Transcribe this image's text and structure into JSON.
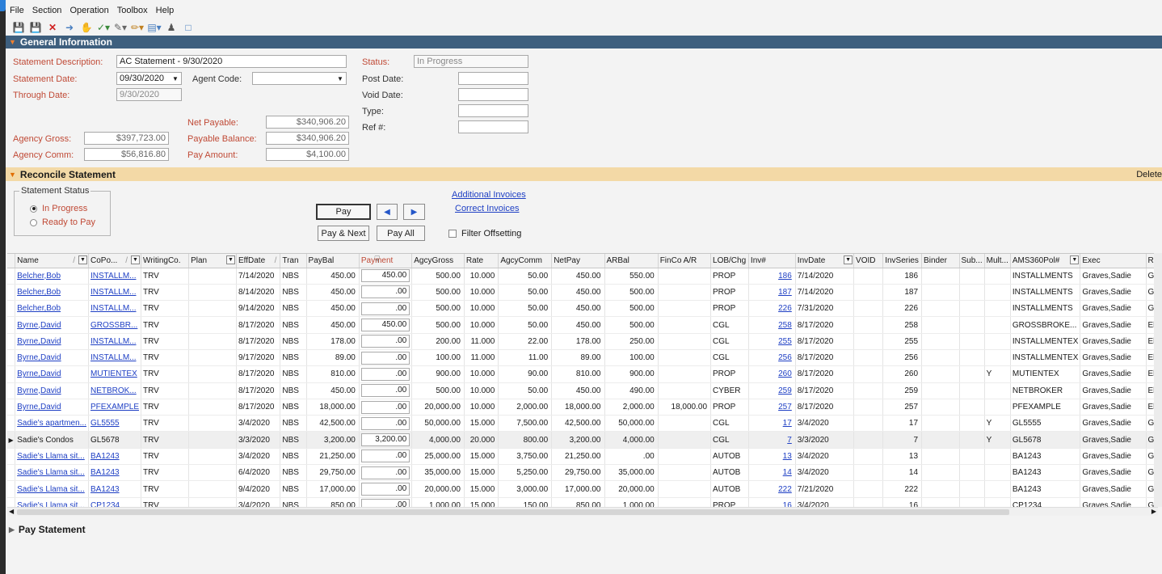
{
  "menu": [
    "File",
    "Section",
    "Operation",
    "Toolbox",
    "Help"
  ],
  "toolbar_icons": [
    "save-icon",
    "save-close-icon",
    "close-x-icon",
    "attach-icon",
    "hand-icon",
    "checkmark-dropdown-icon",
    "attach-dropdown-icon",
    "pen-dropdown-icon",
    "document-dropdown-icon",
    "people-icon",
    "blank-page-icon"
  ],
  "general": {
    "title": "General Information",
    "statement_description_label": "Statement Description:",
    "statement_description": "AC Statement - 9/30/2020",
    "statement_date_label": "Statement Date:",
    "statement_date": "09/30/2020",
    "agent_code_label": "Agent Code:",
    "agent_code": "",
    "through_date_label": "Through Date:",
    "through_date": "9/30/2020",
    "status_label": "Status:",
    "status": "In Progress",
    "post_date_label": "Post Date:",
    "void_date_label": "Void Date:",
    "type_label": "Type:",
    "ref_label": "Ref #:",
    "net_payable_label": "Net Payable:",
    "net_payable": "$340,906.20",
    "agency_gross_label": "Agency Gross:",
    "agency_gross": "$397,723.00",
    "payable_balance_label": "Payable Balance:",
    "payable_balance": "$340,906.20",
    "agency_comm_label": "Agency Comm:",
    "agency_comm": "$56,816.80",
    "pay_amount_label": "Pay Amount:",
    "pay_amount": "$4,100.00"
  },
  "reconcile": {
    "title": "Reconcile Statement",
    "delete": "Delete",
    "status_group": "Statement Status",
    "in_progress": "In Progress",
    "ready_to_pay": "Ready to Pay",
    "pay": "Pay",
    "pay_next": "Pay & Next",
    "pay_all": "Pay All",
    "additional_invoices": "Additional Invoices",
    "correct_invoices": "Correct Invoices",
    "filter_offsetting": "Filter Offsetting"
  },
  "grid": {
    "columns": [
      "Name",
      "CoPo...",
      "WritingCo.",
      "Plan",
      "EffDate",
      "Tran",
      "PayBal",
      "Payment",
      "AgcyGross",
      "Rate",
      "AgcyComm",
      "NetPay",
      "ARBal",
      "FinCo A/R",
      "LOB/Chg",
      "Inv#",
      "InvDate",
      "VOID",
      "InvSeries",
      "Binder",
      "Sub...",
      "Mult...",
      "AMS360Pol#",
      "Exec",
      "R"
    ],
    "rows": [
      [
        "Belcher,Bob",
        "INSTALLM...",
        "TRV",
        "",
        "7/14/2020",
        "NBS",
        "450.00",
        "450.00",
        "500.00",
        "10.000",
        "50.00",
        "450.00",
        "550.00",
        "",
        "PROP",
        "186",
        "7/14/2020",
        "",
        "186",
        "",
        "",
        "",
        "INSTALLMENTS",
        "Graves,Sadie",
        "G"
      ],
      [
        "Belcher,Bob",
        "INSTALLM...",
        "TRV",
        "",
        "8/14/2020",
        "NBS",
        "450.00",
        ".00",
        "500.00",
        "10.000",
        "50.00",
        "450.00",
        "500.00",
        "",
        "PROP",
        "187",
        "7/14/2020",
        "",
        "187",
        "",
        "",
        "",
        "INSTALLMENTS",
        "Graves,Sadie",
        "G"
      ],
      [
        "Belcher,Bob",
        "INSTALLM...",
        "TRV",
        "",
        "9/14/2020",
        "NBS",
        "450.00",
        ".00",
        "500.00",
        "10.000",
        "50.00",
        "450.00",
        "500.00",
        "",
        "PROP",
        "226",
        "7/31/2020",
        "",
        "226",
        "",
        "",
        "",
        "INSTALLMENTS",
        "Graves,Sadie",
        "G"
      ],
      [
        "Byrne,David",
        "GROSSBR...",
        "TRV",
        "",
        "8/17/2020",
        "NBS",
        "450.00",
        "450.00",
        "500.00",
        "10.000",
        "50.00",
        "450.00",
        "500.00",
        "",
        "CGL",
        "258",
        "8/17/2020",
        "",
        "258",
        "",
        "",
        "",
        "GROSSBROKE...",
        "Graves,Sadie",
        "El"
      ],
      [
        "Byrne,David",
        "INSTALLM...",
        "TRV",
        "",
        "8/17/2020",
        "NBS",
        "178.00",
        ".00",
        "200.00",
        "11.000",
        "22.00",
        "178.00",
        "250.00",
        "",
        "CGL",
        "255",
        "8/17/2020",
        "",
        "255",
        "",
        "",
        "",
        "INSTALLMENTEX",
        "Graves,Sadie",
        "El"
      ],
      [
        "Byrne,David",
        "INSTALLM...",
        "TRV",
        "",
        "9/17/2020",
        "NBS",
        "89.00",
        ".00",
        "100.00",
        "11.000",
        "11.00",
        "89.00",
        "100.00",
        "",
        "CGL",
        "256",
        "8/17/2020",
        "",
        "256",
        "",
        "",
        "",
        "INSTALLMENTEX",
        "Graves,Sadie",
        "El"
      ],
      [
        "Byrne,David",
        "MUTIENTEX",
        "TRV",
        "",
        "8/17/2020",
        "NBS",
        "810.00",
        ".00",
        "900.00",
        "10.000",
        "90.00",
        "810.00",
        "900.00",
        "",
        "PROP",
        "260",
        "8/17/2020",
        "",
        "260",
        "",
        "",
        "Y",
        "MUTIENTEX",
        "Graves,Sadie",
        "El"
      ],
      [
        "Byrne,David",
        "NETBROK...",
        "TRV",
        "",
        "8/17/2020",
        "NBS",
        "450.00",
        ".00",
        "500.00",
        "10.000",
        "50.00",
        "450.00",
        "490.00",
        "",
        "CYBER",
        "259",
        "8/17/2020",
        "",
        "259",
        "",
        "",
        "",
        "NETBROKER",
        "Graves,Sadie",
        "El"
      ],
      [
        "Byrne,David",
        "PFEXAMPLE",
        "TRV",
        "",
        "8/17/2020",
        "NBS",
        "18,000.00",
        ".00",
        "20,000.00",
        "10.000",
        "2,000.00",
        "18,000.00",
        "2,000.00",
        "18,000.00",
        "PROP",
        "257",
        "8/17/2020",
        "",
        "257",
        "",
        "",
        "",
        "PFEXAMPLE",
        "Graves,Sadie",
        "El"
      ],
      [
        "Sadie's apartmen...",
        "GL5555",
        "TRV",
        "",
        "3/4/2020",
        "NBS",
        "42,500.00",
        ".00",
        "50,000.00",
        "15.000",
        "7,500.00",
        "42,500.00",
        "50,000.00",
        "",
        "CGL",
        "17",
        "3/4/2020",
        "",
        "17",
        "",
        "",
        "Y",
        "GL5555",
        "Graves,Sadie",
        "G"
      ],
      [
        "Sadie's Condos",
        "GL5678",
        "TRV",
        "",
        "3/3/2020",
        "NBS",
        "3,200.00",
        "3,200.00",
        "4,000.00",
        "20.000",
        "800.00",
        "3,200.00",
        "4,000.00",
        "",
        "CGL",
        "7",
        "3/3/2020",
        "",
        "7",
        "",
        "",
        "Y",
        "GL5678",
        "Graves,Sadie",
        "G"
      ],
      [
        "Sadie's Llama sit...",
        "BA1243",
        "TRV",
        "",
        "3/4/2020",
        "NBS",
        "21,250.00",
        ".00",
        "25,000.00",
        "15.000",
        "3,750.00",
        "21,250.00",
        ".00",
        "",
        "AUTOB",
        "13",
        "3/4/2020",
        "",
        "13",
        "",
        "",
        "",
        "BA1243",
        "Graves,Sadie",
        "G"
      ],
      [
        "Sadie's Llama sit...",
        "BA1243",
        "TRV",
        "",
        "6/4/2020",
        "NBS",
        "29,750.00",
        ".00",
        "35,000.00",
        "15.000",
        "5,250.00",
        "29,750.00",
        "35,000.00",
        "",
        "AUTOB",
        "14",
        "3/4/2020",
        "",
        "14",
        "",
        "",
        "",
        "BA1243",
        "Graves,Sadie",
        "G"
      ],
      [
        "Sadie's Llama sit...",
        "BA1243",
        "TRV",
        "",
        "9/4/2020",
        "NBS",
        "17,000.00",
        ".00",
        "20,000.00",
        "15.000",
        "3,000.00",
        "17,000.00",
        "20,000.00",
        "",
        "AUTOB",
        "222",
        "7/21/2020",
        "",
        "222",
        "",
        "",
        "",
        "BA1243",
        "Graves,Sadie",
        "G"
      ],
      [
        "Sadie's Llama sit...",
        "CP1234",
        "TRV",
        "",
        "3/4/2020",
        "NBS",
        "850.00",
        ".00",
        "1,000.00",
        "15.000",
        "150.00",
        "850.00",
        "1,000.00",
        "",
        "PROP",
        "16",
        "3/4/2020",
        "",
        "16",
        "",
        "",
        "",
        "CP1234",
        "Graves,Sadie",
        "G"
      ]
    ],
    "selected_row": 10
  },
  "pay_statement": {
    "title": "Pay Statement"
  }
}
